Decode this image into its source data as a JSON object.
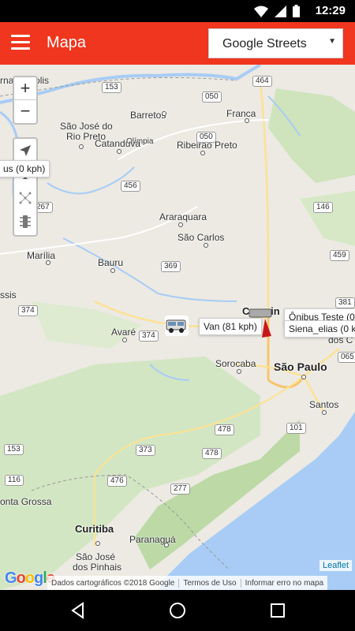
{
  "status_bar": {
    "time": "12:29",
    "icons": [
      "wifi-icon",
      "signal-icon",
      "battery-icon"
    ]
  },
  "app_bar": {
    "title": "Mapa",
    "layer_select": {
      "value": "Google Streets"
    }
  },
  "map": {
    "controls": {
      "zoom_in": "+",
      "zoom_out": "−",
      "tools": [
        "locate-icon",
        "text-icon",
        "network-icon",
        "traffic-light-icon"
      ]
    },
    "labels": {
      "fernandopolis": "rnandópolis",
      "sao_jose_rio_preto_1": "São José do",
      "sao_jose_rio_preto_2": "Rio Preto",
      "olimpia": "Olímpia",
      "barretos": "Barretos",
      "franca": "Franca",
      "catanduva": "Catanduva",
      "ribeirao_preto": "Ribeirão Preto",
      "araraquara": "Araraquara",
      "sao_carlos": "São Carlos",
      "marilia": "Marília",
      "bauru": "Bauru",
      "avare": "Avaré",
      "campinas": "Campin",
      "sorocaba": "Sorocaba",
      "sao_paulo": "São Paulo",
      "santos": "Santos",
      "ponta_grossa": "onta Grossa",
      "curitiba": "Curitiba",
      "paranagua": "Paranaguá",
      "sao_jose_pinhais_1": "São José",
      "sao_jose_pinhais_2": "dos Pinhais",
      "dos_c": "dos C",
      "ssis": "ssis"
    },
    "shields": [
      "153",
      "464",
      "050",
      "050",
      "456",
      "267",
      "146",
      "369",
      "459",
      "374",
      "381",
      "374",
      "065",
      "478",
      "101",
      "153",
      "373",
      "478",
      "476",
      "277",
      "116"
    ],
    "tooltips": {
      "left_partial": "us (0 kph)",
      "van": "Van (81 kph)",
      "onibus": "Ônibus Teste (0",
      "siena": "Siena_elias (0 k"
    },
    "attribution": {
      "data": "Dados cartográficos ©2018 Google",
      "terms": "Termos de Uso",
      "report": "Informar erro no mapa",
      "leaflet": "Leaflet",
      "google_logo": "Google"
    }
  }
}
